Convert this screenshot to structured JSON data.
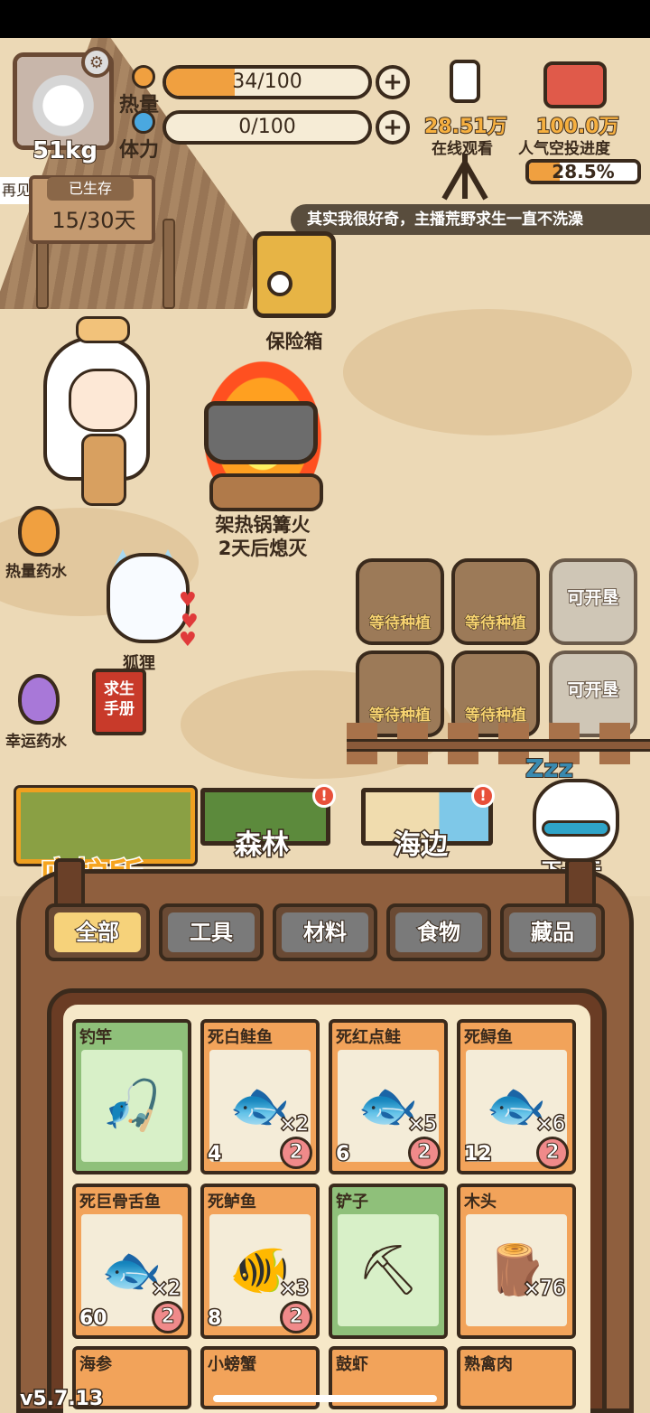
{
  "stats": {
    "weight": "51kg",
    "calories_label": "热量",
    "calories_value": "34/100",
    "calories_fraction": 0.34,
    "stamina_label": "体力",
    "stamina_value": "0/100",
    "stamina_fraction": 0.0
  },
  "survival": {
    "bubble": "再见!",
    "label": "已生存",
    "days": "15/30天"
  },
  "livestream": {
    "viewers": "28.51万",
    "popularity": "100.0万",
    "viewers_label": "在线观看",
    "popularity_label": "人气空投进度",
    "airdrop_progress": "28.5%",
    "airdrop_fraction": 0.285,
    "danmaku": "其实我很好奇，主播荒野求生一直不洗澡"
  },
  "scene": {
    "safe_label": "保险箱",
    "campfire_label_line1": "架热锅篝火",
    "campfire_label_line2": "2天后熄灭",
    "calorie_potion": "热量药水",
    "luck_potion": "幸运药水",
    "fox_label": "狐狸",
    "manual_line1": "求生",
    "manual_line2": "手册"
  },
  "plots": [
    {
      "label": "等待种植",
      "state": "soil"
    },
    {
      "label": "等待种植",
      "state": "soil"
    },
    {
      "label": "可开垦",
      "state": "locked"
    },
    {
      "label": "等待种植",
      "state": "soil"
    },
    {
      "label": "等待种植",
      "state": "soil"
    },
    {
      "label": "可开垦",
      "state": "locked"
    }
  ],
  "locations": {
    "shelter": "庇护所",
    "forest": "森林",
    "sea": "海边",
    "alert_mark": "!",
    "next_day": "下一天",
    "zzz": "Zzz"
  },
  "tabs": [
    "全部",
    "工具",
    "材料",
    "食物",
    "藏品"
  ],
  "active_tab": "全部",
  "inventory": [
    {
      "name": "钓竿",
      "type": "tool",
      "icon": "fishing-rod-icon",
      "glyph": "🎣"
    },
    {
      "name": "死白鲑鱼",
      "type": "food",
      "icon": "dead-whitefish-icon",
      "glyph": "🐟",
      "qty": "×2",
      "calories": "4",
      "spoil": "2"
    },
    {
      "name": "死红点鲑",
      "type": "food",
      "icon": "dead-char-fish-icon",
      "glyph": "🐟",
      "qty": "×5",
      "calories": "6",
      "spoil": "2"
    },
    {
      "name": "死鲟鱼",
      "type": "food",
      "icon": "dead-sturgeon-icon",
      "glyph": "🐟",
      "qty": "×6",
      "calories": "12",
      "spoil": "2"
    },
    {
      "name": "死巨骨舌鱼",
      "type": "food",
      "icon": "dead-arapaima-icon",
      "glyph": "🐟",
      "qty": "×2",
      "calories": "60",
      "spoil": "2"
    },
    {
      "name": "死鲈鱼",
      "type": "food",
      "icon": "dead-bass-icon",
      "glyph": "🐠",
      "qty": "×3",
      "calories": "8",
      "spoil": "2"
    },
    {
      "name": "铲子",
      "type": "tool",
      "icon": "shovel-icon",
      "glyph": "⛏"
    },
    {
      "name": "木头",
      "type": "material",
      "icon": "wood-log-icon",
      "glyph": "🪵",
      "qty": "×76"
    },
    {
      "name": "海参",
      "type": "food",
      "icon": "sea-cucumber-icon"
    },
    {
      "name": "小螃蟹",
      "type": "food",
      "icon": "small-crab-icon"
    },
    {
      "name": "鼓虾",
      "type": "food",
      "icon": "pistol-shrimp-icon"
    },
    {
      "name": "熟禽肉",
      "type": "food",
      "icon": "cooked-poultry-icon"
    }
  ],
  "version": "v5.7.13"
}
